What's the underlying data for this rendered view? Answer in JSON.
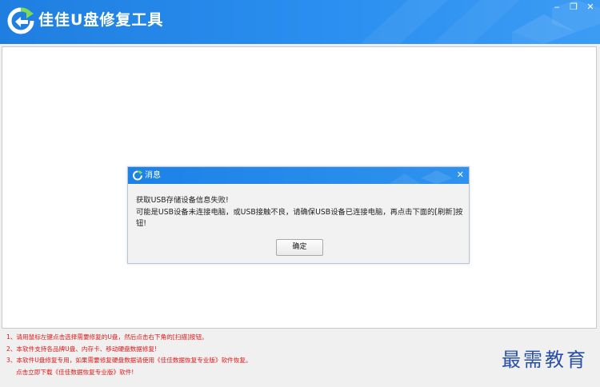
{
  "app": {
    "title": "佳佳U盘修复工具",
    "controls": {
      "minimize": "‒",
      "restore": "❐",
      "close": "✕"
    },
    "logo_icon": "app-logo-icon",
    "accent_color": "#2a8ff0"
  },
  "dialog": {
    "title": "消息",
    "icon": "refresh-logo-icon",
    "close_glyph": "✕",
    "message_line1": "获取USB存储设备信息失败!",
    "message_line2": "可能是USB设备未连接电脑，或USB接触不良，请确保USB设备已连接电脑，再点击下面的[刷新]按",
    "message_line3": "钮!",
    "ok_label": "确定"
  },
  "notes": {
    "line1": "1、请用鼠标左键点击选择需要修复的U盘，然后点击右下角的[扫描]按钮。",
    "line2": "2、本软件支持各品牌U盘、内存卡、移动硬盘数据修复!",
    "line3": "3、本软件U盘修复专用，如果需要修复硬盘数据请使用《佳佳数据恢复专业版》软件恢复。",
    "line4": "点击立即下载《佳佳数据恢复专业版》软件!",
    "color": "#e01818"
  },
  "watermark": {
    "text": "最需教育"
  }
}
